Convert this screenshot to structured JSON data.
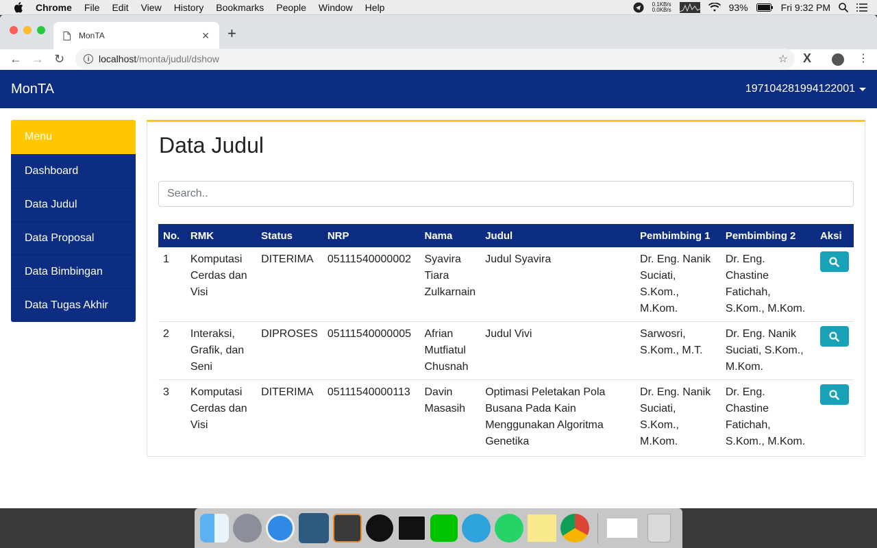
{
  "menubar": {
    "app": "Chrome",
    "items": [
      "File",
      "Edit",
      "View",
      "History",
      "Bookmarks",
      "People",
      "Window",
      "Help"
    ],
    "net_up": "0.1KB/s",
    "net_down": "0.0KB/s",
    "battery": "93%",
    "clock": "Fri 9:32 PM"
  },
  "browser": {
    "tab_title": "MonTA",
    "url_host": "localhost",
    "url_path": "/monta/judul/dshow"
  },
  "navbar": {
    "brand": "MonTA",
    "user": "197104281994122001"
  },
  "sidebar": {
    "header": "Menu",
    "items": [
      {
        "label": "Dashboard"
      },
      {
        "label": "Data Judul"
      },
      {
        "label": "Data Proposal"
      },
      {
        "label": "Data Bimbingan"
      },
      {
        "label": "Data Tugas Akhir"
      }
    ]
  },
  "main": {
    "title": "Data Judul",
    "search_placeholder": "Search..",
    "columns": [
      "No.",
      "RMK",
      "Status",
      "NRP",
      "Nama",
      "Judul",
      "Pembimbing 1",
      "Pembimbing 2",
      "Aksi"
    ],
    "rows": [
      {
        "no": "1",
        "rmk": "Komputasi Cerdas dan Visi",
        "status": "DITERIMA",
        "nrp": "05111540000002",
        "nama": "Syavira Tiara Zulkarnain",
        "judul": "Judul Syavira",
        "p1": "Dr. Eng. Nanik Suciati, S.Kom., M.Kom.",
        "p2": "Dr. Eng. Chastine Fatichah, S.Kom., M.Kom."
      },
      {
        "no": "2",
        "rmk": "Interaksi, Grafik, dan Seni",
        "status": "DIPROSES",
        "nrp": "05111540000005",
        "nama": "Afrian Mutfiatul Chusnah",
        "judul": "Judul Vivi",
        "p1": "Sarwosri, S.Kom., M.T.",
        "p2": "Dr. Eng. Nanik Suciati, S.Kom., M.Kom."
      },
      {
        "no": "3",
        "rmk": "Komputasi Cerdas dan Visi",
        "status": "DITERIMA",
        "nrp": "05111540000113",
        "nama": "Davin Masasih",
        "judul": "Optimasi Peletakan Pola Busana Pada Kain Menggunakan Algoritma Genetika",
        "p1": "Dr. Eng. Nanik Suciati, S.Kom., M.Kom.",
        "p2": "Dr. Eng. Chastine Fatichah, S.Kom., M.Kom."
      }
    ]
  },
  "colors": {
    "primary": "#0d2d82",
    "accent": "#ffc800",
    "button": "#17a2b8"
  }
}
